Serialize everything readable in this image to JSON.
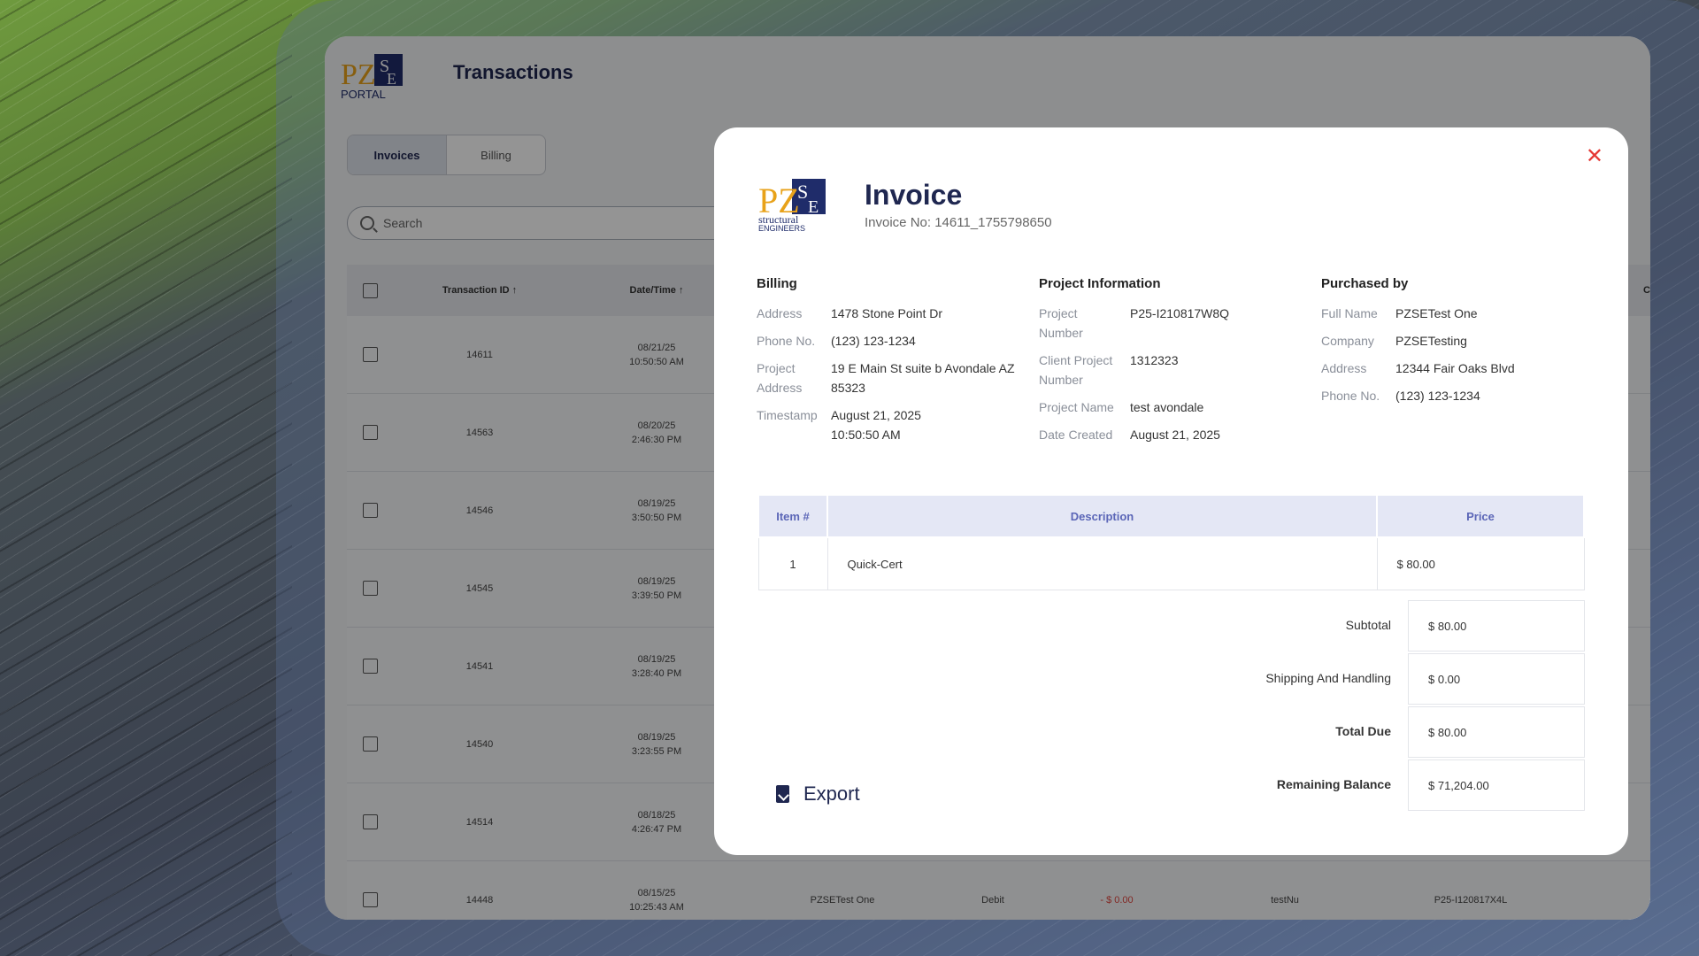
{
  "app": {
    "logo_text": "PZSE PORTAL",
    "title": "Transactions",
    "tabs": [
      {
        "label": "Invoices",
        "active": true
      },
      {
        "label": "Billing",
        "active": false
      }
    ],
    "search_placeholder": "Search",
    "columns": [
      "Transaction ID",
      "Date/Time",
      "Cli"
    ],
    "rows": [
      {
        "id": "14611",
        "date": "08/21/25",
        "time": "10:50:50 AM"
      },
      {
        "id": "14563",
        "date": "08/20/25",
        "time": "2:46:30 PM"
      },
      {
        "id": "14546",
        "date": "08/19/25",
        "time": "3:50:50 PM"
      },
      {
        "id": "14545",
        "date": "08/19/25",
        "time": "3:39:50 PM"
      },
      {
        "id": "14541",
        "date": "08/19/25",
        "time": "3:28:40 PM"
      },
      {
        "id": "14540",
        "date": "08/19/25",
        "time": "3:23:55 PM"
      },
      {
        "id": "14514",
        "date": "08/18/25",
        "time": "4:26:47 PM"
      },
      {
        "id": "14448",
        "date": "08/15/25",
        "time": "10:25:43 AM",
        "name": "PZSETest One",
        "type": "Debit",
        "amount": "- $ 0.00",
        "client": "testNu",
        "project": "P25-I120817X4L"
      }
    ]
  },
  "modal": {
    "logo_text": "PZSE structural ENGINEERS",
    "title": "Invoice",
    "invoice_no": "Invoice No: 14611_1755798650",
    "billing": {
      "heading": "Billing",
      "address_label": "Address",
      "address": "1478 Stone Point Dr",
      "phone_label": "Phone No.",
      "phone": "(123) 123-1234",
      "project_address_label": "Project Address",
      "project_address": "19 E Main St suite b Avondale AZ 85323",
      "timestamp_label": "Timestamp",
      "timestamp": "August 21, 2025 10:50:50 AM"
    },
    "project": {
      "heading": "Project Information",
      "number_label": "Project Number",
      "number": "P25-I210817W8Q",
      "client_label": "Client Project Number",
      "client": "1312323",
      "name_label": "Project Name",
      "name": "test avondale",
      "created_label": "Date Created",
      "created": "August 21, 2025"
    },
    "purchased": {
      "heading": "Purchased by",
      "fullname_label": "Full Name",
      "fullname": "PZSETest One",
      "company_label": "Company",
      "company": "PZSETesting",
      "address_label": "Address",
      "address": "12344 Fair Oaks Blvd",
      "phone_label": "Phone No.",
      "phone": "(123) 123-1234"
    },
    "items_header": {
      "item": "Item #",
      "description": "Description",
      "price": "Price"
    },
    "items": [
      {
        "item": "1",
        "description": "Quick-Cert",
        "price": "$ 80.00"
      }
    ],
    "subtotal_label": "Subtotal",
    "subtotal": "$ 80.00",
    "shipping_label": "Shipping And Handling",
    "shipping": "$ 0.00",
    "total_label": "Total Due",
    "total": "$ 80.00",
    "remaining_label": "Remaining Balance",
    "remaining": "$ 71,204.00",
    "export_label": "Export",
    "close_glyph": "✕"
  },
  "colors": {
    "accent": "#1f2750",
    "close": "#e53935",
    "table_header": "#e4e7f5",
    "negative": "#e0463f"
  }
}
